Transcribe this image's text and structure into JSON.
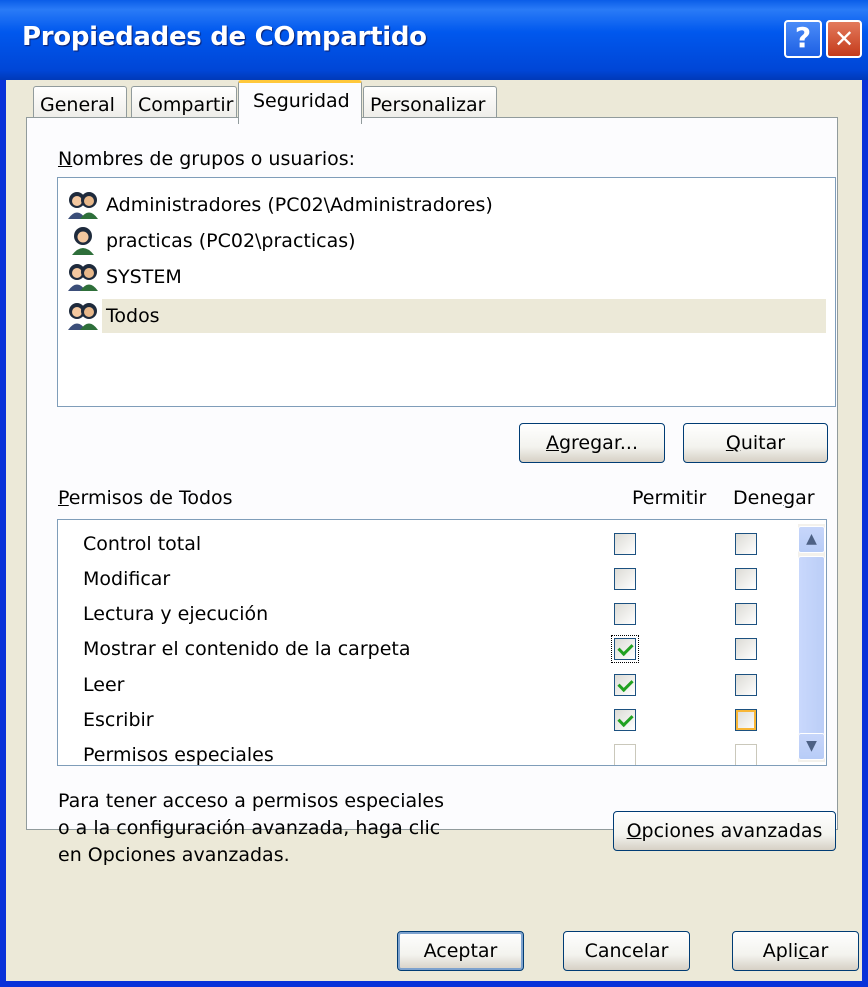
{
  "window": {
    "title": "Propiedades de COmpartido",
    "help_icon": "?",
    "close_icon": "✕"
  },
  "tabs": [
    {
      "label": "General"
    },
    {
      "label": "Compartir"
    },
    {
      "label": "Seguridad"
    },
    {
      "label": "Personalizar"
    }
  ],
  "groups": {
    "label_first": "N",
    "label_rest": "ombres de grupos o usuarios:",
    "items": [
      {
        "name": "Administradores (PC02\\Administradores)",
        "icon": "group-icon"
      },
      {
        "name": "practicas (PC02\\practicas)",
        "icon": "user-icon"
      },
      {
        "name": "SYSTEM",
        "icon": "group-icon"
      },
      {
        "name": "Todos",
        "icon": "group-icon",
        "selected": true
      }
    ],
    "add_first": "A",
    "add_rest": "gregar...",
    "remove_first": "Q",
    "remove_rest": "uitar"
  },
  "permissions": {
    "label_first": "P",
    "label_rest": "ermisos de Todos",
    "allow_header": "Permitir",
    "deny_header_a": "Dene",
    "deny_header_b": "g",
    "deny_header_c": "ar",
    "rows": [
      {
        "name": "Control total",
        "allow": false,
        "deny": false
      },
      {
        "name": "Modificar",
        "allow": false,
        "deny": false
      },
      {
        "name": "Lectura y ejecución",
        "allow": false,
        "deny": false
      },
      {
        "name": "Mostrar el contenido de la carpeta",
        "allow": true,
        "deny": false
      },
      {
        "name": "Leer",
        "allow": true,
        "deny": false
      },
      {
        "name": "Escribir",
        "allow": true,
        "deny": false
      },
      {
        "name": "Permisos especiales",
        "allow": false,
        "deny": false
      }
    ]
  },
  "advanced": {
    "info_line1": "Para tener acceso a permisos especiales",
    "info_line2": "o a la configuración avanzada, haga clic",
    "info_line3": "en Opciones avanzadas.",
    "button_first": "O",
    "button_rest": "pciones avanzadas"
  },
  "footer": {
    "ok": "Aceptar",
    "cancel": "Cancelar",
    "apply_a": "Apli",
    "apply_b": "c",
    "apply_c": "ar"
  }
}
